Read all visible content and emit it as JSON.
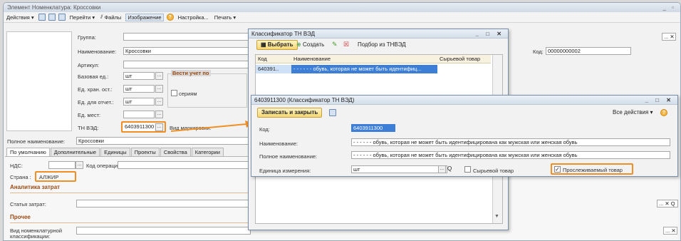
{
  "main": {
    "title": "Элемент Номенклатура: Кроссовки",
    "toolbar": {
      "actions": "Действия",
      "goto": "Перейти",
      "files": "Файлы",
      "image": "Изображение",
      "settings": "Настройка...",
      "print": "Печать"
    },
    "form": {
      "group_label": "Группа:",
      "name_label": "Наименование:",
      "name_value": "Кроссовки",
      "code_label": "Код:",
      "code_value": "00000000002",
      "article_label": "Артикул:",
      "base_unit_label": "Базовая ед.:",
      "base_unit_value": "шт",
      "storage_unit_label": "Ед. хран. ост.:",
      "storage_unit_value": "шт",
      "report_unit_label": "Ед. для отчет.:",
      "report_unit_value": "шт",
      "place_unit_label": "Ед. мест:",
      "tnved_label": "ТН ВЭД:",
      "tnved_value": "6403911300",
      "marking_label": "Вид маркировки:",
      "accounting_group_label": "Вести учет по",
      "series_label": "сериям",
      "full_name_label": "Полное наименование:",
      "full_name_value": "Кроссовки",
      "vat_label": "НДС:",
      "operation_code_label": "Код операции:",
      "country_label": "Страна :",
      "country_value": "АЛЖИР",
      "cost_analytics": "Аналитика затрат",
      "cost_item_label": "Статья затрат:",
      "other": "Прочее",
      "nomenclature_kind_label": "Вид номенклатурной классификации:"
    },
    "tabs": [
      "По умолчанию",
      "Дополнительные",
      "Единицы",
      "Проекты",
      "Свойства",
      "Категории"
    ]
  },
  "classifier": {
    "title": "Классификатор ТН ВЭД",
    "select": "Выбрать",
    "create": "Создать",
    "pick": "Подбор из ТНВЭД",
    "col_code": "Код",
    "col_name": "Наименование",
    "col_raw": "Сырьевой товар",
    "row_code": "640391..",
    "row_name": "- - - - - - обувь, которая не может быть идентифиц..."
  },
  "item": {
    "title": "6403911300 (Классификатор ТН ВЭД)",
    "save_close": "Записать и закрыть",
    "all_actions": "Все действия",
    "code_label": "Код:",
    "code_value": "6403911300",
    "name_label": "Наименование:",
    "name_value": "- - - - - - обувь, которая не может быть идентифицирована как мужская или женская обувь",
    "full_name_label": "Полное наименование:",
    "full_name_value": "- - - - - - обувь, которая не может быть идентифицирована как мужская или женская обувь",
    "unit_label": "Единица измерения:",
    "unit_value": "шт",
    "raw_goods_label": "Сырьевой товар",
    "traceable_label": "Прослеживаемый товар"
  },
  "colors": {
    "highlight": "#ef8f26",
    "selection": "#cfe1f7",
    "section": "#9b4a12"
  }
}
